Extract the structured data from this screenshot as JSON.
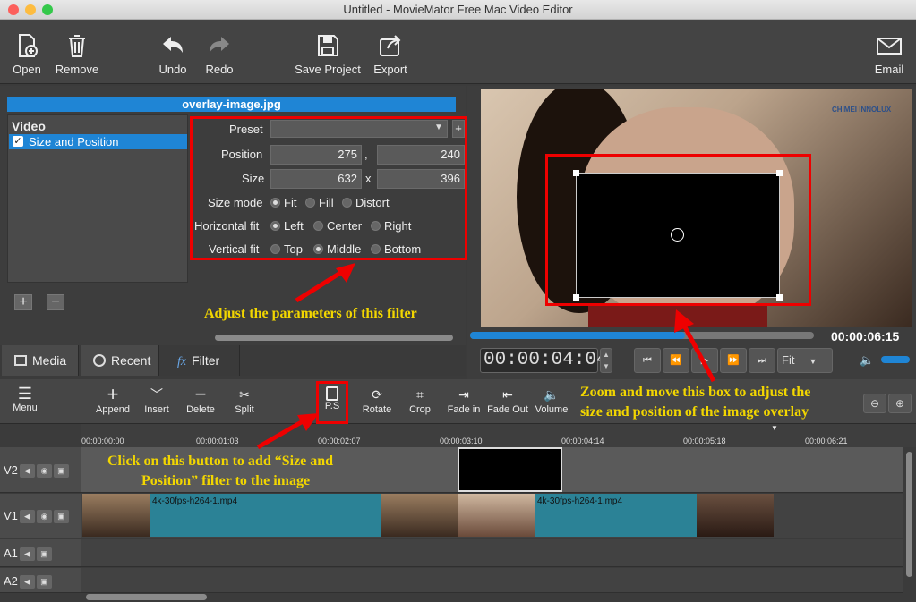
{
  "window": {
    "title": "Untitled - MovieMator Free Mac Video Editor"
  },
  "toolbar": {
    "open": "Open",
    "remove": "Remove",
    "undo": "Undo",
    "redo": "Redo",
    "save": "Save Project",
    "export": "Export",
    "email": "Email"
  },
  "filter": {
    "panel_title": "overlay-image.jpg",
    "list_header": "Video",
    "list_item": "Size and Position",
    "preset_label": "Preset",
    "position_label": "Position",
    "pos_x": "275",
    "pos_sep": ",",
    "pos_y": "240",
    "size_label": "Size",
    "size_w": "632",
    "size_sep": "x",
    "size_h": "396",
    "size_mode_label": "Size mode",
    "size_mode_options": [
      "Fit",
      "Fill",
      "Distort"
    ],
    "hfit_label": "Horizontal fit",
    "hfit_options": [
      "Left",
      "Center",
      "Right"
    ],
    "vfit_label": "Vertical fit",
    "vfit_options": [
      "Top",
      "Middle",
      "Bottom"
    ],
    "add": "+",
    "remove": "−"
  },
  "tabs": {
    "media": "Media",
    "recent": "Recent",
    "filter": "Filter"
  },
  "preview": {
    "total_time": "00:00:06:15",
    "current_time": "00:00:04:04",
    "zoom": "Fit",
    "progress": 0.5
  },
  "timeline_toolbar": {
    "menu": "Menu",
    "append": "Append",
    "insert": "Insert",
    "delete": "Delete",
    "split": "Split",
    "ps": "P.S",
    "rotate": "Rotate",
    "crop": "Crop",
    "fadein": "Fade in",
    "fadeout": "Fade Out",
    "volume": "Volume"
  },
  "ruler": [
    "00:00:00:00",
    "00:00:01:03",
    "00:00:02:07",
    "00:00:03:10",
    "00:00:04:14",
    "00:00:05:18",
    "00:00:06:21"
  ],
  "tracks": {
    "v2": "V2",
    "v1": "V1",
    "a1": "A1",
    "a2": "A2",
    "clip1": "4k-30fps-h264-1.mp4",
    "clip2": "4k-30fps-h264-1.mp4"
  },
  "annotations": {
    "a1": "Adjust the parameters of this filter",
    "a2_line1": "Zoom and move this box to adjust the",
    "a2_line2": "size and position of the image overlay",
    "a3_line1": "Click on this button to add “Size and",
    "a3_line2": "Position” filter to the image"
  },
  "watermark": {
    "brand": "CHIMEI INNOLUX"
  },
  "colors": {
    "accent": "#1f85d5",
    "annotation": "#f2d600",
    "highlight": "#e00000",
    "clip": "#2b8296"
  }
}
